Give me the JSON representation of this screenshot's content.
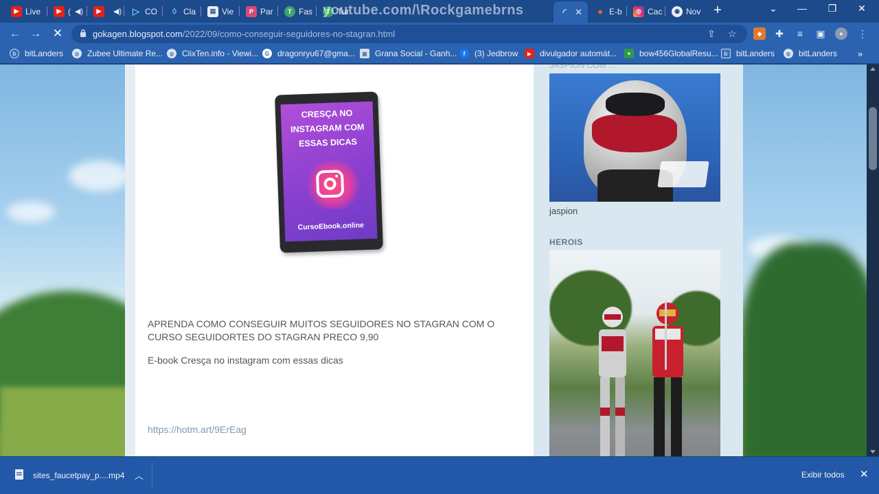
{
  "window": {
    "watermark": "youtube.com/\\Rockgamebrns",
    "tabs": [
      {
        "label": "Live",
        "favicon": "youtube-icon"
      },
      {
        "label": "(",
        "favicon": "youtube-icon"
      },
      {
        "label": "",
        "favicon": "youtube-icon"
      },
      {
        "label": "CO",
        "favicon": "play-icon"
      },
      {
        "label": "Cla",
        "favicon": "drop-icon"
      },
      {
        "label": "Vie",
        "favicon": "page-icon"
      },
      {
        "label": "Par",
        "favicon": "page-icon"
      },
      {
        "label": "Fas",
        "favicon": "t-icon"
      },
      {
        "label": "Tur",
        "favicon": "t-icon"
      },
      {
        "label": "E-b",
        "favicon": "fire-icon"
      },
      {
        "label": "Cac",
        "favicon": "instagram-icon"
      },
      {
        "label": "Nov",
        "favicon": "chrome-icon"
      }
    ],
    "controls": {
      "minimize": "—",
      "maximize": "❐",
      "close": "✕",
      "tab_menu": "⌄",
      "new_tab": "+"
    }
  },
  "toolbar": {
    "url_host": "gokagen.blogspot.com",
    "url_path": "/2022/09/como-conseguir-seguidores-no-stagran.html"
  },
  "bookmarks": [
    {
      "label": "bitLanders",
      "icon": "bitlanders-icon"
    },
    {
      "label": "Zubee Ultimate Re...",
      "icon": "globe-icon"
    },
    {
      "label": "ClixTen.info - Viewi...",
      "icon": "globe-icon"
    },
    {
      "label": "dragonryu67@gma...",
      "icon": "google-icon"
    },
    {
      "label": "Grana Social - Ganh...",
      "icon": "grana-icon"
    },
    {
      "label": "(3) Jedbrow",
      "icon": "facebook-icon"
    },
    {
      "label": "divulgador automát...",
      "icon": "youtube-icon"
    },
    {
      "label": "bow456GlobalResu...",
      "icon": "puzzle-icon"
    },
    {
      "label": "bitLanders",
      "icon": "bitlanders-icon"
    },
    {
      "label": "bitLanders",
      "icon": "globe-icon"
    }
  ],
  "post": {
    "ebook_cover": {
      "title": "CRESÇA NO INSTAGRAM COM ESSAS DICAS",
      "footer": "CursoEbook.online"
    },
    "paragraph1": "APRENDA COMO CONSEGUIR MUITOS SEGUIDORES NO STAGRAN COM O CURSO SEGUIDORTES DO STAGRAN PRECO 9,90",
    "paragraph2": "E-book Cresça no instagram com essas dicas",
    "link": "https://hotm.art/9ErEag"
  },
  "sidebar": {
    "cut_text": "JASPION COM ...",
    "image1_caption": "jaspion",
    "section_heading": "HEROIS"
  },
  "download_bar": {
    "file_name": "sites_faucetpay_p....mp4",
    "show_all": "Exibir todos"
  },
  "colors": {
    "tab_bg": "#1c4a8a",
    "toolbar_bg": "#2b63b0",
    "download_bar": "#2258a8",
    "link": "#7a9bb8"
  }
}
